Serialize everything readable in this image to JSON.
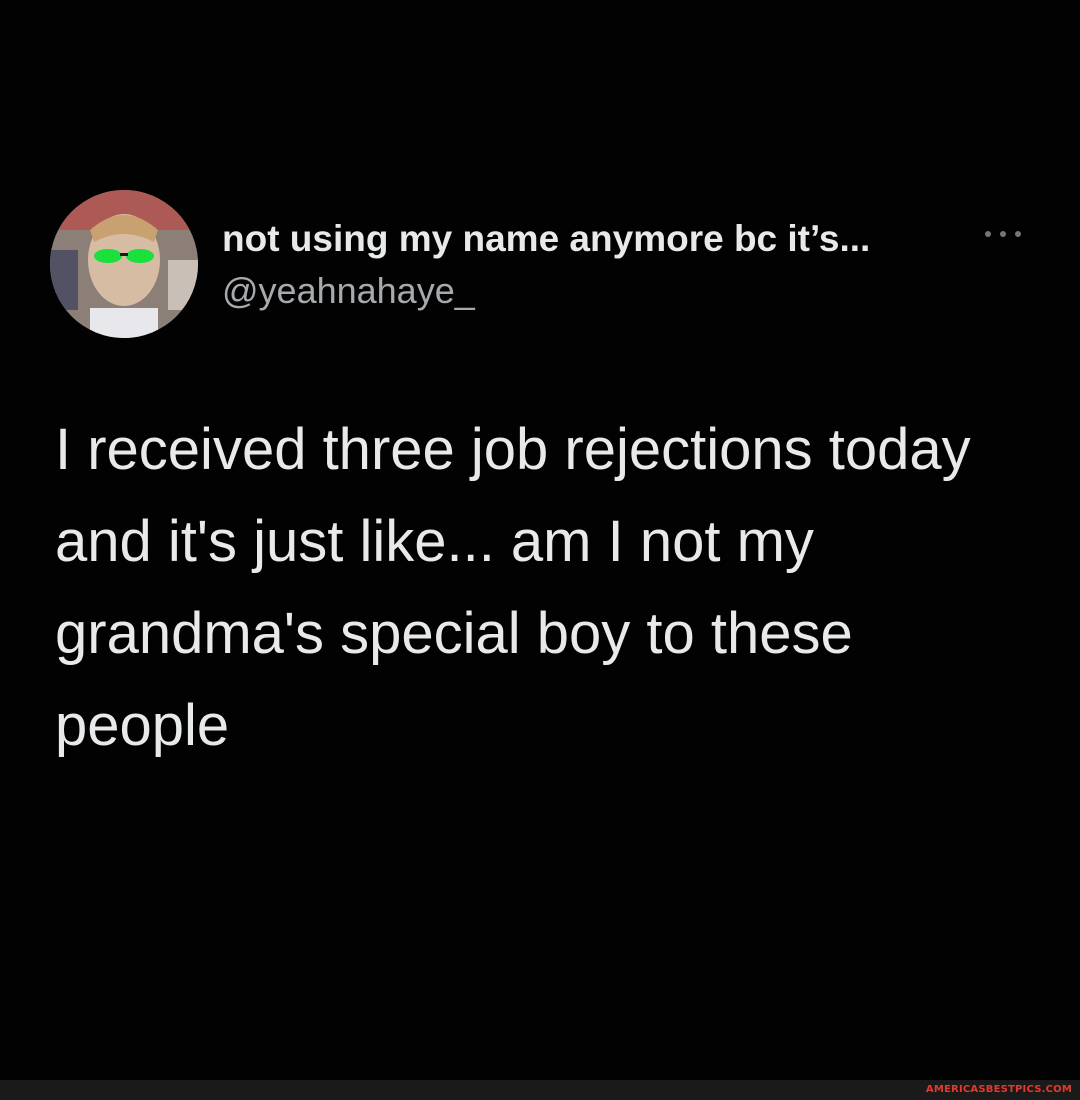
{
  "tweet": {
    "display_name": "not using my name anymore bc it’s...",
    "handle": "@yeahnahaye_",
    "text": "I received three job rejections today\nand it's just like... am I not my\ngrandma's special boy to these\npeople",
    "avatar_icon": "profile-avatar",
    "more_icon": "more-options-icon"
  },
  "footer": {
    "watermark": "AMERICASBESTPICS.COM"
  },
  "colors": {
    "background": "#000000",
    "text_primary": "#e7e9ea",
    "text_secondary": "#a7aaad",
    "watermark": "#e23b2e"
  }
}
